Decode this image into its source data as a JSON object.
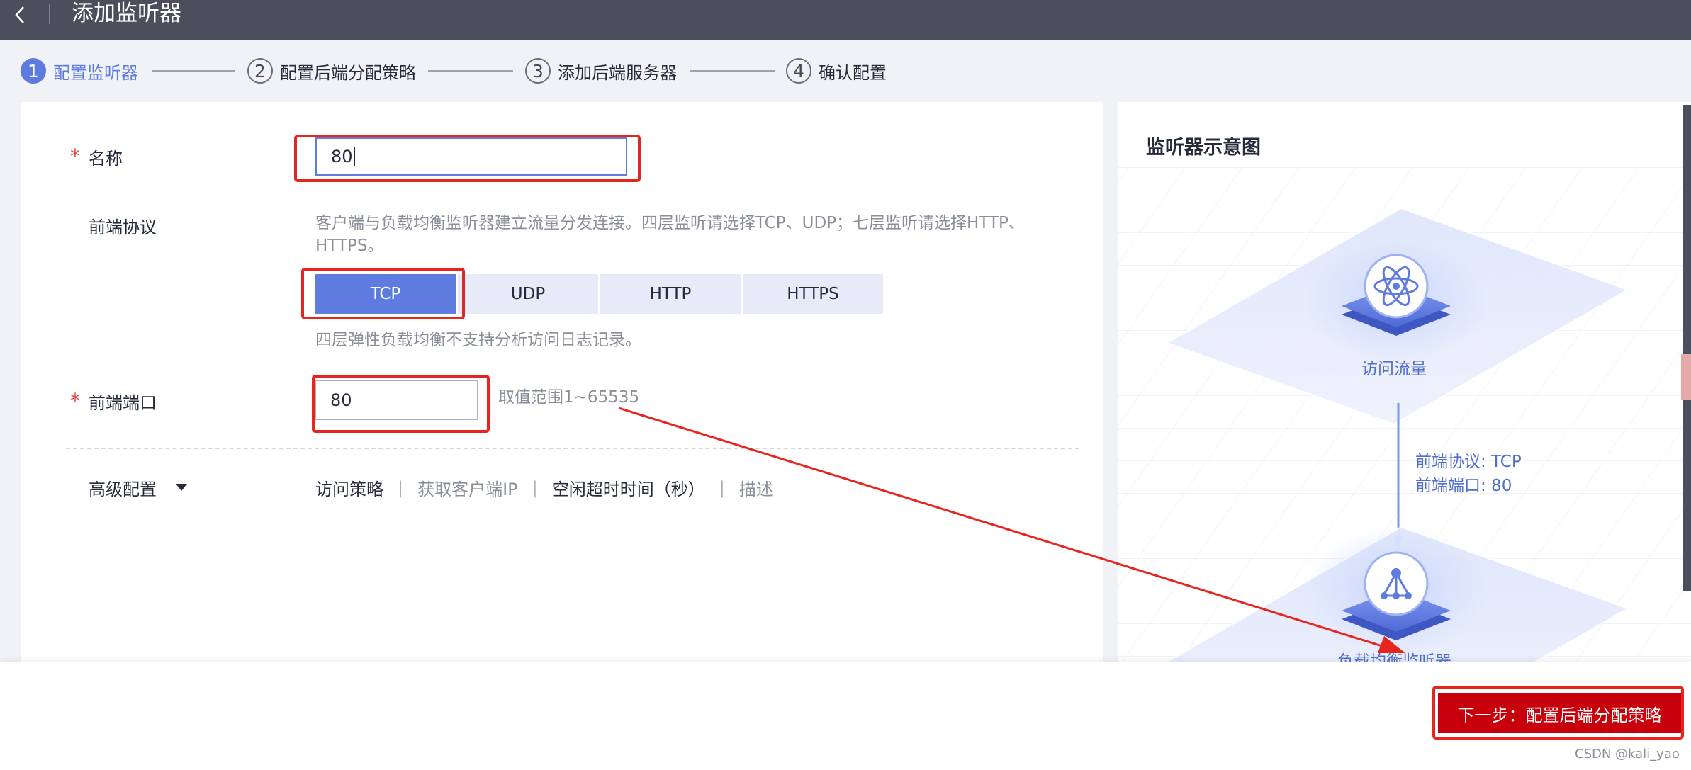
{
  "header": {
    "title": "添加监听器",
    "back_icon": "chevron-left-icon"
  },
  "steps": [
    {
      "number": "1",
      "label": "配置监听器",
      "active": true
    },
    {
      "number": "2",
      "label": "配置后端分配策略",
      "active": false
    },
    {
      "number": "3",
      "label": "添加后端服务器",
      "active": false
    },
    {
      "number": "4",
      "label": "确认配置",
      "active": false
    }
  ],
  "form": {
    "name": {
      "required_mark": "*",
      "label": "名称",
      "value": "80"
    },
    "protocol": {
      "label": "前端协议",
      "help": "客户端与负载均衡监听器建立流量分发连接。四层监听请选择TCP、UDP；七层监听请选择HTTP、HTTPS。",
      "options": [
        "TCP",
        "UDP",
        "HTTP",
        "HTTPS"
      ],
      "selected": "TCP",
      "note": "四层弹性负载均衡不支持分析访问日志记录。"
    },
    "port": {
      "required_mark": "*",
      "label": "前端端口",
      "value": "80",
      "range_hint": "取值范围1~65535"
    },
    "advanced": {
      "label": "高级配置",
      "links": [
        "访问策略",
        "获取客户端IP",
        "空闲超时时间（秒）",
        "描述"
      ],
      "separator": "|"
    }
  },
  "diagram": {
    "title": "监听器示意图",
    "top_node_label": "访问流量",
    "protocol_line": "前端协议: TCP",
    "port_line": "前端端口: 80",
    "bottom_node_label": "负载均衡监听器",
    "top_icon": "atom-icon",
    "bottom_icon": "network-hub-icon"
  },
  "footer": {
    "next_label": "下一步：配置后端分配策略"
  },
  "watermark": "CSDN @kali_yao",
  "colors": {
    "header_bg": "#4b4f5c",
    "accent": "#5e7ce0",
    "primary_red": "#c7000b",
    "annotation_red": "#e8241f",
    "page_bg": "#f1f2f6"
  }
}
